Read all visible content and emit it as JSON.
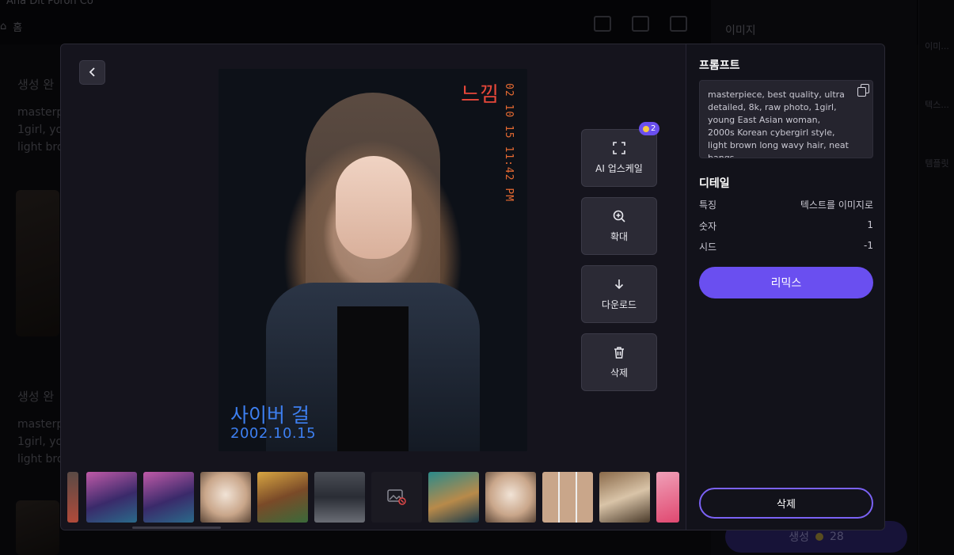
{
  "background": {
    "app_title": "Aha Dit Poron Co",
    "home_label": "홈",
    "generated_label": "생성 완",
    "prompt_preview_1": "masterp",
    "prompt_preview_2": "1girl, yo",
    "prompt_preview_3": "light bro",
    "right_panel_title": "이미지",
    "rail_items": [
      "이미...",
      "텍스...",
      "템플릿"
    ],
    "generate_button": "생성",
    "generate_cost": "28"
  },
  "modal": {
    "back_label": "‹",
    "image_texts": {
      "top_korean": "느낌",
      "vertical_date": "02 10 15  11:42 PM",
      "cyber_girl": "사이버 걸",
      "date": "2002.10.15"
    },
    "actions": {
      "upscale_label": "AI 업스케일",
      "upscale_cost": "2",
      "zoom_label": "확대",
      "download_label": "다운로드",
      "delete_label": "삭제"
    },
    "prompt_title": "프롬프트",
    "prompt_text": "masterpiece, best quality, ultra detailed, 8k, raw photo, 1girl, young East Asian woman, 2000s Korean cybergirl style, light brown long wavy hair, neat bangs",
    "details_title": "디테일",
    "details": [
      {
        "label": "특징",
        "value": "텍스트를 이미지로"
      },
      {
        "label": "숫자",
        "value": "1"
      },
      {
        "label": "시드",
        "value": "-1"
      }
    ],
    "remix_label": "리믹스",
    "delete_label": "삭제",
    "thumbnails": [
      "partial-crop",
      "pink-hair-girl",
      "pink-hair-girl-2",
      "elf-portrait",
      "toy-characters",
      "armored-woman",
      "broken-image",
      "cat-card",
      "elf-portrait-2",
      "cat-grid",
      "cat-collage",
      "pink-poster"
    ],
    "colors": {
      "accent": "#6a4ff0",
      "modal_bg": "#15141d",
      "panel_bg": "#12121a",
      "button_bg": "#2b2a35"
    }
  }
}
